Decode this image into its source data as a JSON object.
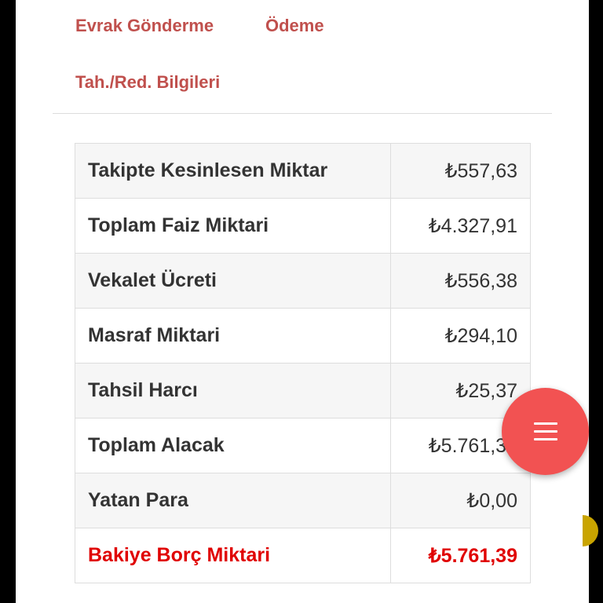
{
  "tabs": [
    {
      "label": "Evrak Gönderme"
    },
    {
      "label": "Ödeme"
    },
    {
      "label": "Tah./Red. Bilgileri"
    }
  ],
  "summary_table": {
    "rows": [
      {
        "label": "Takipte Kesinlesen Miktar",
        "value": "₺557,63"
      },
      {
        "label": "Toplam Faiz Miktari",
        "value": "₺4.327,91"
      },
      {
        "label": "Vekalet Ücreti",
        "value": "₺556,38"
      },
      {
        "label": "Masraf Miktari",
        "value": "₺294,10"
      },
      {
        "label": "Tahsil Harcı",
        "value": "₺25,37"
      },
      {
        "label": "Toplam Alacak",
        "value": "₺5.761,39"
      },
      {
        "label": "Yatan Para",
        "value": "₺0,00"
      },
      {
        "label": "Bakiye Borç Miktari",
        "value": "₺5.761,39"
      }
    ]
  },
  "fab": {
    "icon": "menu-icon"
  },
  "colors": {
    "tab_text": "#c0504d",
    "highlight_text": "#e00000",
    "fab_background": "#f25252"
  }
}
